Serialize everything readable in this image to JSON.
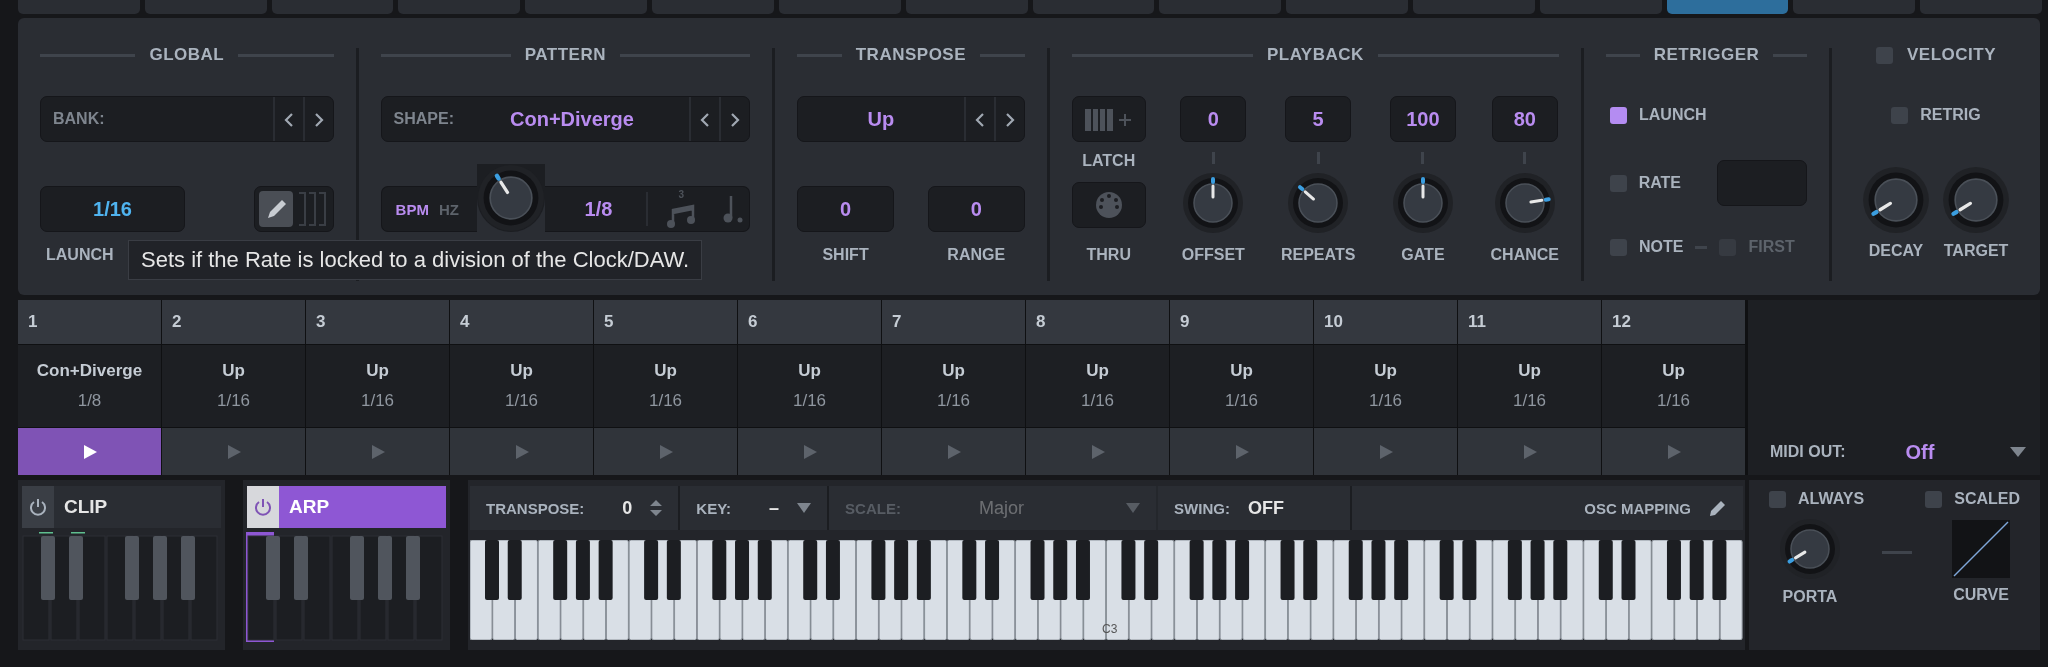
{
  "top_tabs": [
    {
      "selected": false
    },
    {
      "selected": false
    },
    {
      "selected": false
    },
    {
      "selected": false
    },
    {
      "selected": false
    },
    {
      "selected": false
    },
    {
      "selected": false
    },
    {
      "selected": false
    },
    {
      "selected": false
    },
    {
      "selected": false
    },
    {
      "selected": false
    },
    {
      "selected": false
    },
    {
      "selected": false
    },
    {
      "selected": true
    },
    {
      "selected": false
    },
    {
      "selected": false
    }
  ],
  "global": {
    "title": "GLOBAL",
    "bank_label": "BANK:",
    "rate_value": "1/16",
    "edit_on": true,
    "launch_label": "LAUNCH"
  },
  "pattern": {
    "title": "PATTERN",
    "shape_label": "SHAPE:",
    "shape_value": "Con+Diverge",
    "modes": [
      {
        "label": "BPM",
        "selected": true
      },
      {
        "label": "HZ",
        "selected": false
      }
    ],
    "rate_value": "1/8",
    "triplet_label": "3"
  },
  "transpose": {
    "title": "TRANSPOSE",
    "direction": "Up",
    "shift": "0",
    "shift_label": "SHIFT",
    "range": "0",
    "range_label": "RANGE"
  },
  "playback": {
    "title": "PLAYBACK",
    "latch_label": "LATCH",
    "thru_label": "THRU",
    "knobs": [
      {
        "value": "0",
        "label": "OFFSET"
      },
      {
        "value": "5",
        "label": "REPEATS"
      },
      {
        "value": "100",
        "label": "GATE"
      },
      {
        "value": "80",
        "label": "CHANCE"
      }
    ]
  },
  "retrigger": {
    "title": "RETRIGGER",
    "launch": {
      "label": "LAUNCH",
      "checked": true
    },
    "rate": {
      "label": "RATE",
      "checked": false
    },
    "note": {
      "label": "NOTE",
      "checked": false
    },
    "first": {
      "label": "FIRST",
      "checked": false,
      "disabled": true
    }
  },
  "velocity": {
    "title": "VELOCITY",
    "enabled": false,
    "retrig": {
      "label": "RETRIG",
      "checked": false
    },
    "knobs": [
      {
        "label": "DECAY"
      },
      {
        "label": "TARGET"
      }
    ]
  },
  "tooltip": "Sets if the Rate is locked to a division of the Clock/DAW.",
  "slots": [
    {
      "number": "1",
      "shape": "Con+Diverge",
      "rate": "1/8",
      "selected": true
    },
    {
      "number": "2",
      "shape": "Up",
      "rate": "1/16",
      "selected": false
    },
    {
      "number": "3",
      "shape": "Up",
      "rate": "1/16",
      "selected": false
    },
    {
      "number": "4",
      "shape": "Up",
      "rate": "1/16",
      "selected": false
    },
    {
      "number": "5",
      "shape": "Up",
      "rate": "1/16",
      "selected": false
    },
    {
      "number": "6",
      "shape": "Up",
      "rate": "1/16",
      "selected": false
    },
    {
      "number": "7",
      "shape": "Up",
      "rate": "1/16",
      "selected": false
    },
    {
      "number": "8",
      "shape": "Up",
      "rate": "1/16",
      "selected": false
    },
    {
      "number": "9",
      "shape": "Up",
      "rate": "1/16",
      "selected": false
    },
    {
      "number": "10",
      "shape": "Up",
      "rate": "1/16",
      "selected": false
    },
    {
      "number": "11",
      "shape": "Up",
      "rate": "1/16",
      "selected": false
    },
    {
      "number": "12",
      "shape": "Up",
      "rate": "1/16",
      "selected": false
    }
  ],
  "midi_out": {
    "label": "MIDI OUT:",
    "value": "Off"
  },
  "clip": {
    "label": "CLIP",
    "on": false
  },
  "arp": {
    "label": "ARP",
    "on": true
  },
  "toolbar": {
    "transpose_label": "TRANSPOSE:",
    "transpose_value": "0",
    "key_label": "KEY:",
    "key_value": "–",
    "scale_label": "SCALE:",
    "scale_value": "Major",
    "scale_disabled": true,
    "swing_label": "SWING:",
    "swing_value": "OFF",
    "osc_label": "OSC MAPPING"
  },
  "keyboard": {
    "marker": "C3"
  },
  "porta": {
    "always": {
      "label": "ALWAYS",
      "checked": false
    },
    "scaled": {
      "label": "SCALED",
      "checked": false
    },
    "label": "PORTA",
    "curve_label": "CURVE"
  }
}
